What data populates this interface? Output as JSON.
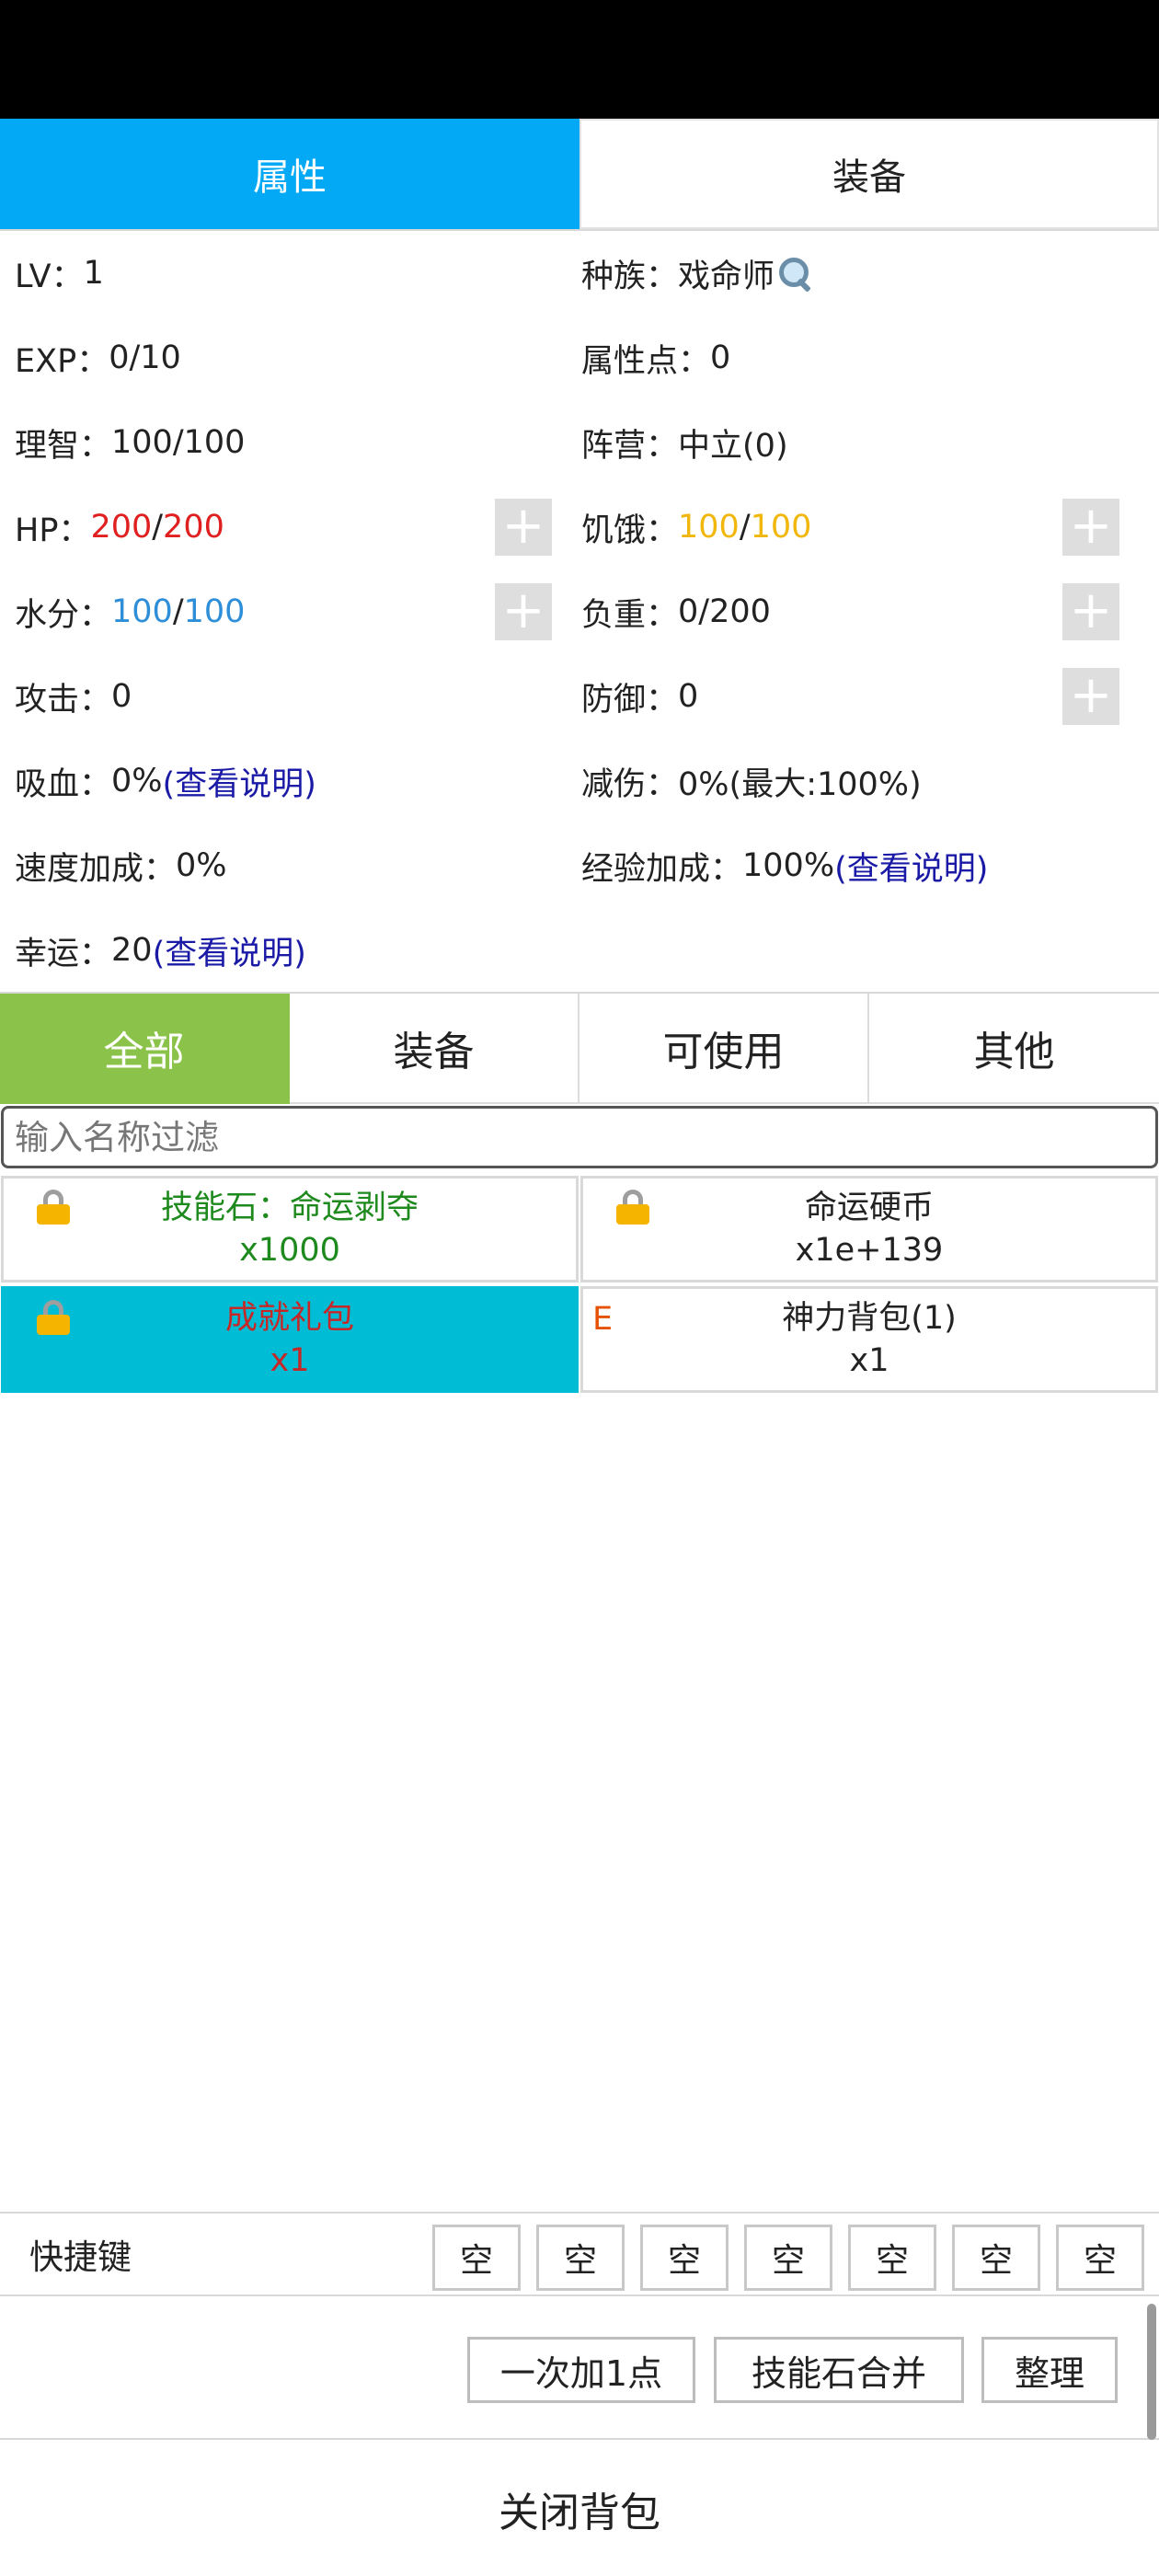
{
  "main_tabs": [
    {
      "label": "属性",
      "active": true
    },
    {
      "label": "装备",
      "active": false
    }
  ],
  "stats": {
    "lv_label": "LV：",
    "lv_value": "1",
    "race_label": "种族：",
    "race_value": "戏命师",
    "exp_label": "EXP：",
    "exp_value": "0/10",
    "attr_points_label": "属性点：",
    "attr_points_value": "0",
    "sanity_label": "理智：",
    "sanity_value": "100/100",
    "faction_label": "阵营：",
    "faction_value": "中立(0)",
    "hp_label": "HP：",
    "hp_current": "200",
    "hp_sep": "/",
    "hp_max": "200",
    "hunger_label": "饥饿：",
    "hunger_current": "100",
    "hunger_sep": "/",
    "hunger_max": "100",
    "water_label": "水分：",
    "water_current": "100",
    "water_sep": "/",
    "water_max": "100",
    "load_label": "负重：",
    "load_value": "0/200",
    "attack_label": "攻击：",
    "attack_value": "0",
    "defense_label": "防御：",
    "defense_value": "0",
    "lifesteal_label": "吸血：",
    "lifesteal_value": "0%",
    "lifesteal_link": "(查看说明)",
    "damage_reduction_label": "减伤：",
    "damage_reduction_value": "0%(最大:100%)",
    "speed_bonus_label": "速度加成：",
    "speed_bonus_value": "0%",
    "exp_bonus_label": "经验加成：",
    "exp_bonus_value": "100%",
    "exp_bonus_link": "(查看说明)",
    "luck_label": "幸运：",
    "luck_value": "20",
    "luck_link": "(查看说明)",
    "plus_symbol": "+"
  },
  "filter_tabs": [
    {
      "label": "全部",
      "active": true
    },
    {
      "label": "装备",
      "active": false
    },
    {
      "label": "可使用",
      "active": false
    },
    {
      "label": "其他",
      "active": false
    }
  ],
  "filter": {
    "placeholder": "输入名称过滤",
    "value": ""
  },
  "items": [
    {
      "name": "技能石：命运剥夺",
      "qty": "x1000",
      "locked": true,
      "color": "#1e8a1e"
    },
    {
      "name": "命运硬币",
      "qty": "x1e+139",
      "locked": true,
      "color": "#222222"
    },
    {
      "name": "成就礼包",
      "qty": "x1",
      "locked": true,
      "selected": true,
      "color": "#c62828"
    },
    {
      "name": "神力背包(1)",
      "qty": "x1",
      "marker": "E",
      "color": "#222222"
    }
  ],
  "shortcuts": {
    "label": "快捷键",
    "slots": [
      "空",
      "空",
      "空",
      "空",
      "空",
      "空",
      "空"
    ]
  },
  "actions": {
    "add_one": "一次加1点",
    "merge_stones": "技能石合并",
    "sort": "整理"
  },
  "close_label": "关闭背包",
  "colors": {
    "active_tab": "#03a9f4",
    "active_filter": "#8bc34a",
    "selected_item": "#00bcd4",
    "hp": "#e02020",
    "hunger": "#f1b70c",
    "water": "#2e8fd8",
    "link": "#1a1aa6"
  },
  "icons": {
    "race_info": "search-icon",
    "locked": "lock-icon",
    "plus": "plus-icon"
  }
}
